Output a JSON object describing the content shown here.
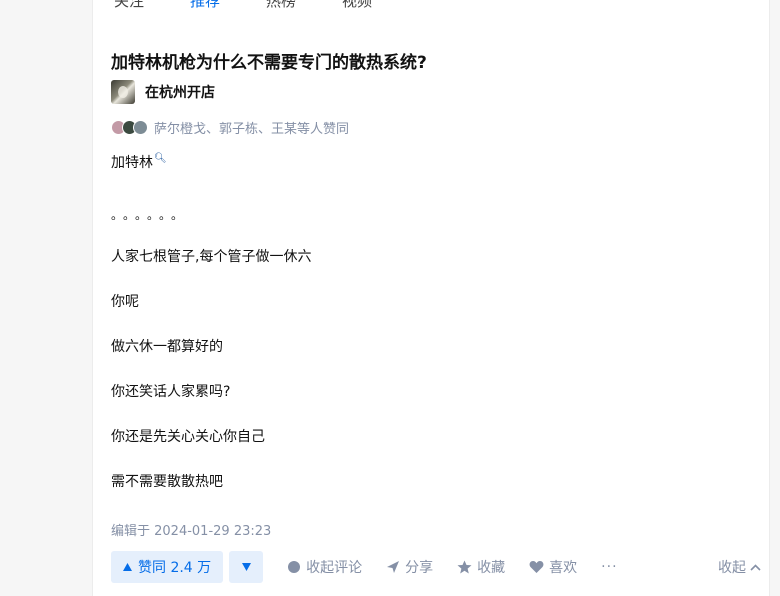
{
  "tabs": [
    "关注",
    "推荐",
    "热榜",
    "视频"
  ],
  "question": {
    "title": "加特林机枪为什么不需要专门的散热系统?"
  },
  "author": {
    "name": "在杭州开店"
  },
  "voters_text": "萨尔橙戈、郭子栋、王某等人赞同",
  "content": {
    "line1": "加特林",
    "line2": "。。。。。。",
    "line3": "人家七根管子,每个管子做一休六",
    "line4": "你呢",
    "line5": "做六休一都算好的",
    "line6": "你还笑话人家累吗?",
    "line7": "你还是先关心关心你自己",
    "line8": "需不需要散散热吧"
  },
  "edit_time": "编辑于 2024-01-29 23:23",
  "actions": {
    "vote_up": "赞同 2.4 万",
    "comment": "收起评论",
    "share": "分享",
    "favorite": "收藏",
    "like": "喜欢",
    "more": "···",
    "collapse": "收起"
  },
  "icons": {
    "search": "search-icon",
    "vote_up": "triangle-up-icon",
    "vote_down": "triangle-down-icon",
    "comment": "comment-bubble-icon",
    "share": "paper-plane-icon",
    "favorite": "star-icon",
    "like": "heart-icon",
    "collapse": "chevron-up-icon"
  },
  "colors": {
    "accent": "#056de8",
    "muted": "#8590a6",
    "vote_bg": "#e5effc"
  }
}
